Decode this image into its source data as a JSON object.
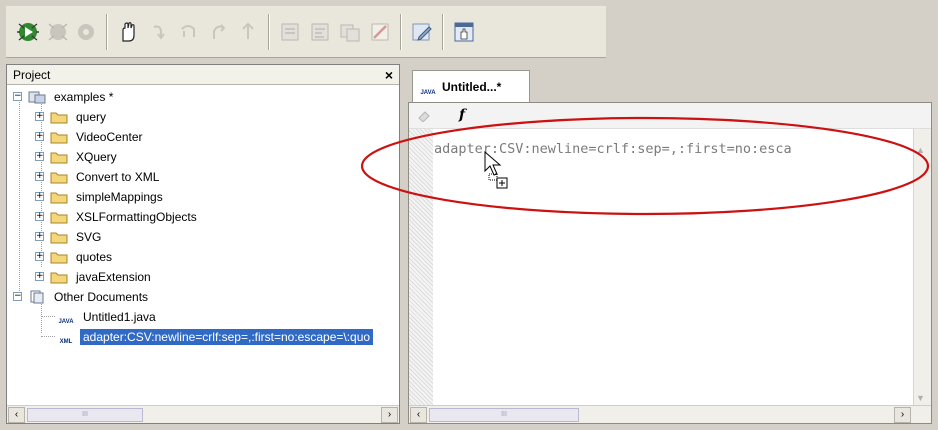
{
  "toolbar": {
    "icons": [
      "debug-run-icon",
      "debug-stop-icon",
      "debug-settings-icon",
      "hand-icon",
      "step-into-icon",
      "step-over-icon",
      "step-out-icon",
      "step-back-icon",
      "xml-pane-icon",
      "xml-pane2-icon",
      "xml-pane3-icon",
      "xml-disabled-icon",
      "edit-icon",
      "window-icon"
    ]
  },
  "project": {
    "title": "Project",
    "close_label": "×",
    "root": "examples *",
    "folders": [
      "query",
      "VideoCenter",
      "XQuery",
      "Convert to XML",
      "simpleMappings",
      "XSLFormattingObjects",
      "SVG",
      "quotes",
      "javaExtension"
    ],
    "other_documents": "Other Documents",
    "files": [
      {
        "name": "Untitled1.java",
        "badge": "JAVA"
      },
      {
        "name": "adapter:CSV:newline=crlf:sep=,:first=no:escape=\\:quo",
        "badge": "XML"
      }
    ]
  },
  "editor": {
    "tab_label": "Untitled...*",
    "tab_badge": "JAVA",
    "tool_icon": "f",
    "code_line": "adapter:CSV:newline=crlf:sep=,:first=no:esca"
  },
  "scroll": {
    "left": "‹",
    "right": "›",
    "up": "▲",
    "down": "▼",
    "thumb": "III"
  },
  "colors": {
    "selection": "#316ac5",
    "highlight_ellipse": "#cc1111"
  }
}
